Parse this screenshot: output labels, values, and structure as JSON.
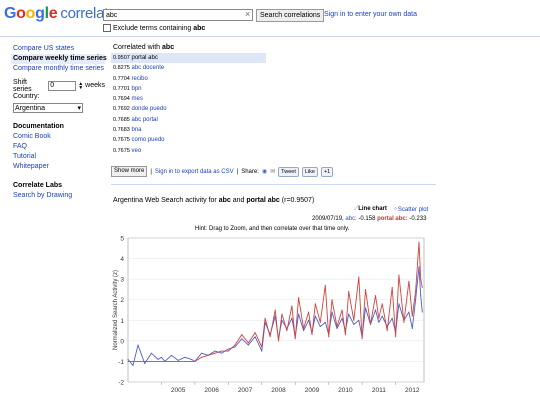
{
  "header": {
    "logo_text": "Google",
    "product": "correlate",
    "search_value": "abc",
    "search_button": "Search correlations",
    "signin_link": "Sign in to enter your own data",
    "exclude_label": "Exclude terms containing",
    "exclude_term": "abc"
  },
  "sidebar": {
    "compare_items": [
      "Compare US states",
      "Compare weekly time series",
      "Compare monthly time series"
    ],
    "selected_index": 1,
    "shift_label": "Shift series",
    "shift_value": "0",
    "shift_unit": "weeks",
    "country_label": "Country:",
    "country_value": "Argentina",
    "doc_heading": "Documentation",
    "doc_links": [
      "Comic Book",
      "FAQ",
      "Tutorial",
      "Whitepaper"
    ],
    "labs_heading": "Correlate Labs",
    "labs_links": [
      "Search by Drawing"
    ]
  },
  "results": {
    "heading_prefix": "Correlated with",
    "heading_term": "abc",
    "rows": [
      {
        "value": "0.9507",
        "term": "portal abc"
      },
      {
        "value": "0.8275",
        "term": "abc docente"
      },
      {
        "value": "0.7704",
        "term": "recibo"
      },
      {
        "value": "0.7701",
        "term": "bpn"
      },
      {
        "value": "0.7694",
        "term": "mes"
      },
      {
        "value": "0.7692",
        "term": "donde puedo"
      },
      {
        "value": "0.7685",
        "term": "abc portal"
      },
      {
        "value": "0.7683",
        "term": "bna"
      },
      {
        "value": "0.7675",
        "term": "como puedo"
      },
      {
        "value": "0.7675",
        "term": "veo"
      }
    ],
    "selected_index": 0
  },
  "toolbar": {
    "show_more": "Show more",
    "export": "Sign in to export data as CSV",
    "share_label": "Share:",
    "share_buttons": [
      "Tweet",
      "Like",
      "+1"
    ]
  },
  "chart_header": {
    "title_prefix": "Argentina Web Search activity for",
    "term_a": "abc",
    "and": "and",
    "term_b": "portal abc",
    "r_value": "(r=0.9507)",
    "line_chart": "Line chart",
    "scatter_plot": "Scatter plot",
    "hover_date": "2009/07/19,",
    "hover_a_label": "abc:",
    "hover_a_value": "-0.158",
    "hover_b_label": "portal abc:",
    "hover_b_value": "-0.233",
    "hint": "Hint: Drag to Zoom, and then correlate over that time only."
  },
  "chart_data": {
    "type": "line",
    "ylabel": "Normalized Search Activity (z)",
    "ylim": [
      -2,
      5
    ],
    "xlim": [
      2004.0,
      2012.85
    ],
    "yticks": [
      -2,
      -1,
      0,
      1,
      2,
      3,
      4,
      5
    ],
    "xticks": [
      2005,
      2006,
      2007,
      2008,
      2009,
      2010,
      2011,
      2012
    ],
    "series": [
      {
        "name": "abc",
        "color": "#4a5fcf",
        "x": [
          2004.0,
          2004.15,
          2004.3,
          2004.5,
          2004.7,
          2004.9,
          2005.0,
          2005.1,
          2005.3,
          2005.5,
          2005.7,
          2005.9,
          2006.0,
          2006.2,
          2006.4,
          2006.6,
          2006.8,
          2007.0,
          2007.2,
          2007.4,
          2007.6,
          2007.8,
          2008.0,
          2008.1,
          2008.25,
          2008.4,
          2008.5,
          2008.6,
          2008.75,
          2008.9,
          2009.0,
          2009.1,
          2009.25,
          2009.4,
          2009.5,
          2009.6,
          2009.75,
          2009.9,
          2010.0,
          2010.1,
          2010.25,
          2010.4,
          2010.5,
          2010.6,
          2010.75,
          2010.9,
          2011.0,
          2011.1,
          2011.25,
          2011.4,
          2011.5,
          2011.6,
          2011.75,
          2011.9,
          2012.0,
          2012.1,
          2012.25,
          2012.4,
          2012.5,
          2012.6,
          2012.7,
          2012.75,
          2012.8
        ],
        "y": [
          -0.9,
          -1.2,
          -0.2,
          -1.1,
          -0.6,
          -0.9,
          -0.8,
          -1.0,
          -0.7,
          -0.95,
          -0.8,
          -0.9,
          -1.0,
          -0.6,
          -0.7,
          -0.5,
          -0.6,
          -0.4,
          -0.3,
          0.1,
          -0.2,
          0.2,
          -0.5,
          0.9,
          0.3,
          1.2,
          0.1,
          1.0,
          0.6,
          1.1,
          0.2,
          1.3,
          0.5,
          1.0,
          0.4,
          1.2,
          0.7,
          0.9,
          0.3,
          1.4,
          0.6,
          1.1,
          0.5,
          1.3,
          0.8,
          1.0,
          0.2,
          1.6,
          0.8,
          1.5,
          0.9,
          1.2,
          0.7,
          1.1,
          0.4,
          1.8,
          1.0,
          1.4,
          0.6,
          2.0,
          3.6,
          2.2,
          1.4
        ]
      },
      {
        "name": "portal abc",
        "color": "#d0443c",
        "x": [
          2004.0,
          2004.15,
          2004.3,
          2004.5,
          2004.7,
          2004.9,
          2005.0,
          2005.1,
          2005.3,
          2005.5,
          2005.7,
          2005.9,
          2006.0,
          2006.2,
          2006.4,
          2006.6,
          2006.8,
          2007.0,
          2007.2,
          2007.4,
          2007.6,
          2007.8,
          2008.0,
          2008.1,
          2008.25,
          2008.4,
          2008.5,
          2008.6,
          2008.75,
          2008.9,
          2009.0,
          2009.1,
          2009.25,
          2009.4,
          2009.5,
          2009.6,
          2009.75,
          2009.9,
          2010.0,
          2010.1,
          2010.25,
          2010.4,
          2010.5,
          2010.6,
          2010.75,
          2010.9,
          2011.0,
          2011.1,
          2011.25,
          2011.4,
          2011.5,
          2011.6,
          2011.75,
          2011.9,
          2012.0,
          2012.1,
          2012.25,
          2012.4,
          2012.5,
          2012.6,
          2012.7,
          2012.75,
          2012.8
        ],
        "y": [
          -1.0,
          -1.0,
          -1.0,
          -1.0,
          -1.0,
          -1.0,
          -1.0,
          -1.0,
          -1.0,
          -1.0,
          -1.0,
          -1.0,
          -1.0,
          -0.8,
          -0.7,
          -0.6,
          -0.5,
          -0.5,
          -0.2,
          0.3,
          -0.1,
          0.4,
          -0.3,
          1.1,
          0.2,
          1.5,
          0.0,
          1.3,
          0.5,
          1.7,
          0.1,
          2.1,
          0.6,
          1.4,
          0.3,
          1.8,
          0.9,
          2.7,
          0.2,
          2.0,
          0.7,
          1.5,
          0.3,
          2.4,
          1.0,
          3.1,
          0.1,
          2.5,
          0.8,
          2.2,
          1.1,
          1.8,
          0.5,
          2.6,
          0.2,
          3.2,
          0.9,
          2.9,
          1.2,
          2.4,
          4.8,
          3.0,
          2.6
        ]
      }
    ]
  }
}
